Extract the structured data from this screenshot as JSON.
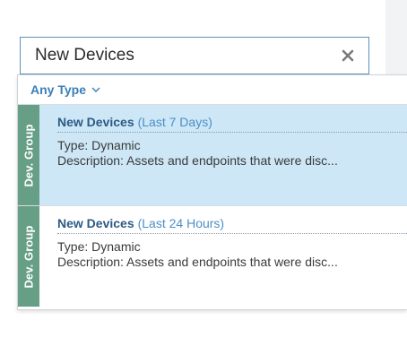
{
  "search": {
    "value": "New Devices",
    "clear_icon": "close-icon"
  },
  "filter": {
    "label": "Any Type",
    "icon": "chevron-down-icon"
  },
  "results": [
    {
      "tag": "Dev. Group",
      "title": "New Devices",
      "qualifier": "(Last 7 Days)",
      "type_line": "Type: Dynamic",
      "description_line": "Description: Assets and endpoints that were disc...",
      "selected": true
    },
    {
      "tag": "Dev. Group",
      "title": "New Devices",
      "qualifier": "(Last 24 Hours)",
      "type_line": "Type: Dynamic",
      "description_line": "Description: Assets and endpoints that were disc...",
      "selected": false
    }
  ],
  "colors": {
    "selected_row": "#cde7f6",
    "tag_green": "#669e86",
    "title_blue": "#2c5a86",
    "accent_blue": "#3a7fb8"
  }
}
